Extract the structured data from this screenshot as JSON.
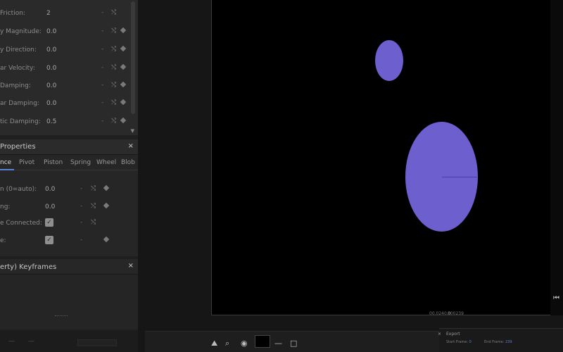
{
  "physics_panel": {
    "rows": [
      {
        "label": "Friction:",
        "value": "2"
      },
      {
        "label": "y Magnitude:",
        "value": "0.0"
      },
      {
        "label": "y Direction:",
        "value": "0.0"
      },
      {
        "label": "ar Velocity:",
        "value": "0.0"
      },
      {
        "label": "Damping:",
        "value": "0.0"
      },
      {
        "label": "ar Damping:",
        "value": "0.0"
      },
      {
        "label": "tic Damping:",
        "value": "0.5"
      }
    ]
  },
  "joint_panel": {
    "title": "Properties",
    "close": "×",
    "tabs": [
      "nce",
      "Pivot",
      "Piston",
      "Spring",
      "Wheel",
      "Blob"
    ],
    "rows": [
      {
        "label": "n (0=auto):",
        "value": "0.0"
      },
      {
        "label": "ng:",
        "value": "0.0"
      },
      {
        "label": "e Connected:",
        "checked": "✓"
      },
      {
        "label": "e:",
        "checked": "✓"
      }
    ]
  },
  "keyframes_panel": {
    "title": "erty) Keyframes",
    "close": "×"
  },
  "viewport": {
    "time_current": "00.0240.0",
    "time_total": "000239",
    "circle_color": "#6e5fcf",
    "background": "#000000"
  },
  "toolbar": {
    "icons": [
      "mountain-icon",
      "zoom-icon",
      "eye-icon",
      "line-tool-icon",
      "rectangle-tool-icon"
    ]
  },
  "export_panel": {
    "title": "Export",
    "start_frame_label": "Start Frame:",
    "start_frame_value": "0",
    "end_frame_label": "End Frame:",
    "end_frame_value": "239"
  },
  "glyphs": {
    "dash": "-",
    "shuffle": "⤭",
    "scroll_down": "▼",
    "close": "×",
    "play_start": "⏮",
    "play": "▶",
    "mountain": "⛰",
    "zoom": "⌕",
    "eye": "◉",
    "line": "—",
    "rect": "□"
  }
}
